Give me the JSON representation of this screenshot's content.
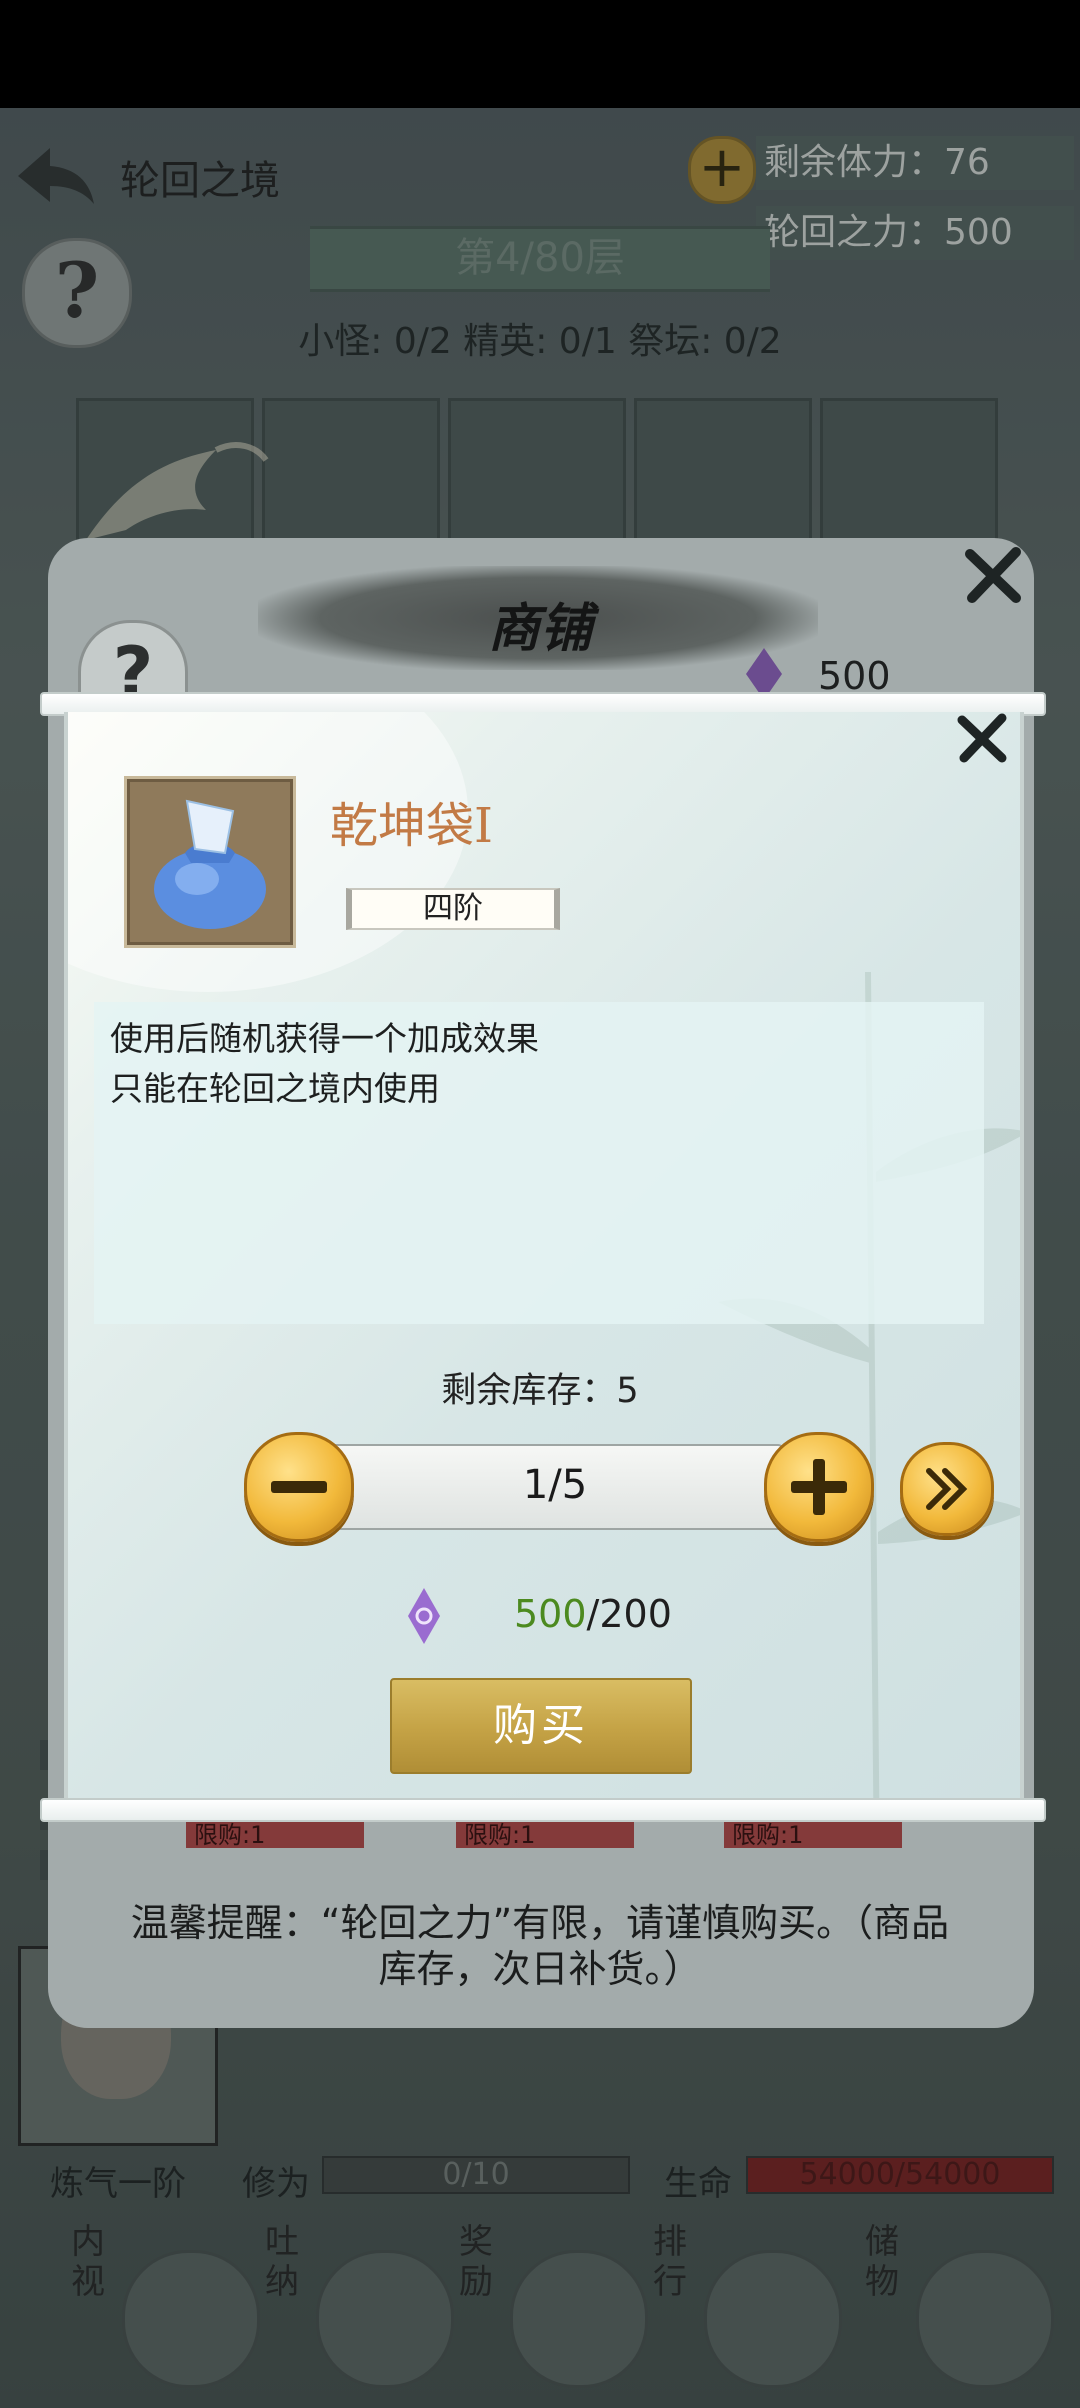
{
  "header": {
    "title": "轮回之境",
    "stamina_label": "剩余体力：",
    "stamina_value": "76",
    "power_label": "轮回之力：",
    "power_value": "500",
    "layer": "第4/80层",
    "counters": "小怪: 0/2 精英: 0/1 祭坛: 0/2"
  },
  "shop": {
    "title": "商铺",
    "currency": "500",
    "limits": [
      "限购:1",
      "限购:1",
      "限购:1"
    ],
    "reminder_line1": "温馨提醒：“轮回之力”有限，请谨慎购买。（商品",
    "reminder_line2": "库存，次日补货。）"
  },
  "dialog": {
    "item_name": "乾坤袋I",
    "tier": "四阶",
    "description": [
      "使用后随机获得一个加成效果",
      "只能在轮回之境内使用"
    ],
    "stock_label": "剩余库存：",
    "stock_value": "5",
    "quantity": "1/5",
    "price_have": "500",
    "price_cost": "/200",
    "buy_label": "购买",
    "icons": {
      "minus": "minus-icon",
      "plus": "plus-icon",
      "max": "double-chevron-right-icon",
      "currency": "purple-gem-icon"
    }
  },
  "player": {
    "realm": "炼气一阶",
    "cultivation_label": "修为",
    "cultivation_value": "0/10",
    "cultivation_progress": 0.0,
    "hp_label": "生命",
    "hp_value": "54000/54000",
    "hp_progress": 1.0
  },
  "nav": [
    {
      "tag": "内视",
      "icon": "eye-icon"
    },
    {
      "tag": "吐纳",
      "icon": "meditation-icon"
    },
    {
      "tag": "奖励",
      "icon": "gift-icon"
    },
    {
      "tag": "排行",
      "icon": "ranking-icon"
    },
    {
      "tag": "储物",
      "icon": "bag-icon"
    }
  ],
  "colors": {
    "accent_gold": "#f2b93b",
    "item_name": "#c27a45",
    "price_have": "#4c8a1f",
    "hp_bar": "#6f1d1d"
  }
}
